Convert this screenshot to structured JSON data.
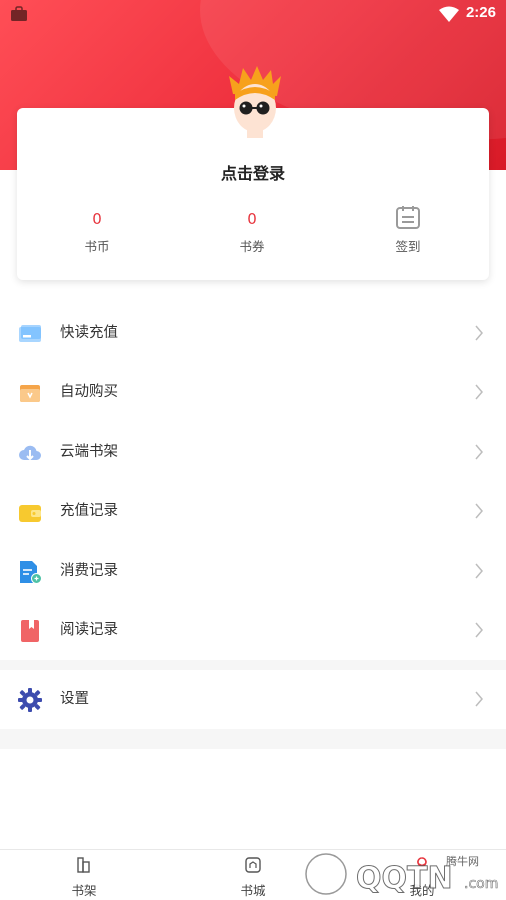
{
  "status_bar": {
    "time": "2:26"
  },
  "profile": {
    "login_label": "点击登录",
    "book_coins": {
      "value": "0",
      "label": "书币"
    },
    "book_tickets": {
      "value": "0",
      "label": "书券"
    },
    "sign_in": {
      "label": "签到",
      "icon": "calendar-icon"
    }
  },
  "menu": [
    {
      "label": "快读充值",
      "icon": "card-icon",
      "color": "#6ab7ff"
    },
    {
      "label": "自动购买",
      "icon": "wallet-icon",
      "color": "#f5a54a"
    },
    {
      "label": "云端书架",
      "icon": "cloud-icon",
      "color": "#5b8ee8"
    },
    {
      "label": "充值记录",
      "icon": "wallet-card-icon",
      "color": "#f7c92f"
    },
    {
      "label": "消费记录",
      "icon": "document-icon",
      "color": "#2f8fe6"
    },
    {
      "label": "阅读记录",
      "icon": "book-icon",
      "color": "#f06466"
    }
  ],
  "settings": {
    "label": "设置",
    "icon": "gear-icon",
    "color": "#3d4cae"
  },
  "bottom_nav": [
    {
      "label": "书架",
      "icon": "bookshelf-icon"
    },
    {
      "label": "书城",
      "icon": "bookstore-icon"
    },
    {
      "label": "我的",
      "icon": "profile-icon"
    }
  ],
  "watermark": {
    "text": "腾牛网",
    "brand": "QQTN.com"
  },
  "colors": {
    "accent": "#e7353e",
    "header_red": "#ee2f3d"
  }
}
